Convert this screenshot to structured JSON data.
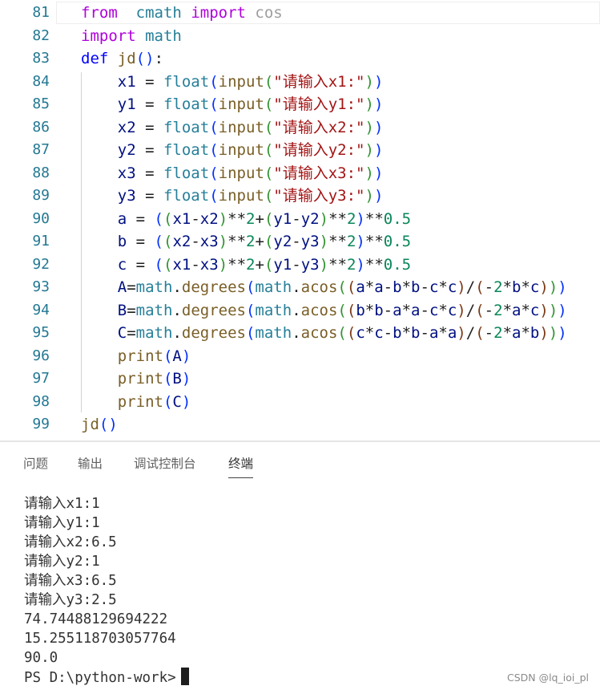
{
  "editor": {
    "lines": [
      {
        "num": "81",
        "tokens": [
          [
            "kw",
            "from"
          ],
          [
            "",
            "  "
          ],
          [
            "mod",
            "cmath"
          ],
          [
            "",
            " "
          ],
          [
            "kw",
            "import"
          ],
          [
            "",
            " "
          ],
          [
            "faded",
            "cos"
          ]
        ]
      },
      {
        "num": "82",
        "tokens": [
          [
            "kw",
            "import"
          ],
          [
            "",
            " "
          ],
          [
            "mod",
            "math"
          ]
        ]
      },
      {
        "num": "83",
        "tokens": [
          [
            "kwb",
            "def"
          ],
          [
            "",
            " "
          ],
          [
            "fn",
            "jd"
          ],
          [
            "p1",
            "()"
          ],
          [
            "",
            ":"
          ]
        ]
      },
      {
        "num": "84",
        "tokens": [
          [
            "",
            "    "
          ],
          [
            "var",
            "x1"
          ],
          [
            "",
            " = "
          ],
          [
            "mod",
            "float"
          ],
          [
            "p1",
            "("
          ],
          [
            "fn",
            "input"
          ],
          [
            "p2",
            "("
          ],
          [
            "str",
            "\"请输入x1:\""
          ],
          [
            "p2",
            ")"
          ],
          [
            "p1",
            ")"
          ]
        ]
      },
      {
        "num": "85",
        "tokens": [
          [
            "",
            "    "
          ],
          [
            "var",
            "y1"
          ],
          [
            "",
            " = "
          ],
          [
            "mod",
            "float"
          ],
          [
            "p1",
            "("
          ],
          [
            "fn",
            "input"
          ],
          [
            "p2",
            "("
          ],
          [
            "str",
            "\"请输入y1:\""
          ],
          [
            "p2",
            ")"
          ],
          [
            "p1",
            ")"
          ]
        ]
      },
      {
        "num": "86",
        "tokens": [
          [
            "",
            "    "
          ],
          [
            "var",
            "x2"
          ],
          [
            "",
            " = "
          ],
          [
            "mod",
            "float"
          ],
          [
            "p1",
            "("
          ],
          [
            "fn",
            "input"
          ],
          [
            "p2",
            "("
          ],
          [
            "str",
            "\"请输入x2:\""
          ],
          [
            "p2",
            ")"
          ],
          [
            "p1",
            ")"
          ]
        ]
      },
      {
        "num": "87",
        "tokens": [
          [
            "",
            "    "
          ],
          [
            "var",
            "y2"
          ],
          [
            "",
            " = "
          ],
          [
            "mod",
            "float"
          ],
          [
            "p1",
            "("
          ],
          [
            "fn",
            "input"
          ],
          [
            "p2",
            "("
          ],
          [
            "str",
            "\"请输入y2:\""
          ],
          [
            "p2",
            ")"
          ],
          [
            "p1",
            ")"
          ]
        ]
      },
      {
        "num": "88",
        "tokens": [
          [
            "",
            "    "
          ],
          [
            "var",
            "x3"
          ],
          [
            "",
            " = "
          ],
          [
            "mod",
            "float"
          ],
          [
            "p1",
            "("
          ],
          [
            "fn",
            "input"
          ],
          [
            "p2",
            "("
          ],
          [
            "str",
            "\"请输入x3:\""
          ],
          [
            "p2",
            ")"
          ],
          [
            "p1",
            ")"
          ]
        ]
      },
      {
        "num": "89",
        "tokens": [
          [
            "",
            "    "
          ],
          [
            "var",
            "y3"
          ],
          [
            "",
            " = "
          ],
          [
            "mod",
            "float"
          ],
          [
            "p1",
            "("
          ],
          [
            "fn",
            "input"
          ],
          [
            "p2",
            "("
          ],
          [
            "str",
            "\"请输入y3:\""
          ],
          [
            "p2",
            ")"
          ],
          [
            "p1",
            ")"
          ]
        ]
      },
      {
        "num": "90",
        "tokens": [
          [
            "",
            "    "
          ],
          [
            "var",
            "a"
          ],
          [
            "",
            " = "
          ],
          [
            "p1",
            "("
          ],
          [
            "p2",
            "("
          ],
          [
            "var",
            "x1"
          ],
          [
            "",
            "-"
          ],
          [
            "var",
            "x2"
          ],
          [
            "p2",
            ")"
          ],
          [
            "",
            "**"
          ],
          [
            "num",
            "2"
          ],
          [
            "",
            "+"
          ],
          [
            "p2",
            "("
          ],
          [
            "var",
            "y1"
          ],
          [
            "",
            "-"
          ],
          [
            "var",
            "y2"
          ],
          [
            "p2",
            ")"
          ],
          [
            "",
            "**"
          ],
          [
            "num",
            "2"
          ],
          [
            "p1",
            ")"
          ],
          [
            "",
            "**"
          ],
          [
            "num",
            "0.5"
          ]
        ]
      },
      {
        "num": "91",
        "tokens": [
          [
            "",
            "    "
          ],
          [
            "var",
            "b"
          ],
          [
            "",
            " = "
          ],
          [
            "p1",
            "("
          ],
          [
            "p2",
            "("
          ],
          [
            "var",
            "x2"
          ],
          [
            "",
            "-"
          ],
          [
            "var",
            "x3"
          ],
          [
            "p2",
            ")"
          ],
          [
            "",
            "**"
          ],
          [
            "num",
            "2"
          ],
          [
            "",
            "+"
          ],
          [
            "p2",
            "("
          ],
          [
            "var",
            "y2"
          ],
          [
            "",
            "-"
          ],
          [
            "var",
            "y3"
          ],
          [
            "p2",
            ")"
          ],
          [
            "",
            "**"
          ],
          [
            "num",
            "2"
          ],
          [
            "p1",
            ")"
          ],
          [
            "",
            "**"
          ],
          [
            "num",
            "0.5"
          ]
        ]
      },
      {
        "num": "92",
        "tokens": [
          [
            "",
            "    "
          ],
          [
            "var",
            "c"
          ],
          [
            "",
            " = "
          ],
          [
            "p1",
            "("
          ],
          [
            "p2",
            "("
          ],
          [
            "var",
            "x1"
          ],
          [
            "",
            "-"
          ],
          [
            "var",
            "x3"
          ],
          [
            "p2",
            ")"
          ],
          [
            "",
            "**"
          ],
          [
            "num",
            "2"
          ],
          [
            "",
            "+"
          ],
          [
            "p2",
            "("
          ],
          [
            "var",
            "y1"
          ],
          [
            "",
            "-"
          ],
          [
            "var",
            "y3"
          ],
          [
            "p2",
            ")"
          ],
          [
            "",
            "**"
          ],
          [
            "num",
            "2"
          ],
          [
            "p1",
            ")"
          ],
          [
            "",
            "**"
          ],
          [
            "num",
            "0.5"
          ]
        ]
      },
      {
        "num": "93",
        "tokens": [
          [
            "",
            "    "
          ],
          [
            "var",
            "A"
          ],
          [
            "",
            "="
          ],
          [
            "mod",
            "math"
          ],
          [
            "",
            "."
          ],
          [
            "fn",
            "degrees"
          ],
          [
            "p1",
            "("
          ],
          [
            "mod",
            "math"
          ],
          [
            "",
            "."
          ],
          [
            "fn",
            "acos"
          ],
          [
            "p2",
            "("
          ],
          [
            "p3",
            "("
          ],
          [
            "var",
            "a"
          ],
          [
            "",
            "*"
          ],
          [
            "var",
            "a"
          ],
          [
            "",
            "-"
          ],
          [
            "var",
            "b"
          ],
          [
            "",
            "*"
          ],
          [
            "var",
            "b"
          ],
          [
            "",
            "-"
          ],
          [
            "var",
            "c"
          ],
          [
            "",
            "*"
          ],
          [
            "var",
            "c"
          ],
          [
            "p3",
            ")"
          ],
          [
            "",
            "/"
          ],
          [
            "p3",
            "("
          ],
          [
            "",
            "-"
          ],
          [
            "num",
            "2"
          ],
          [
            "",
            "*"
          ],
          [
            "var",
            "b"
          ],
          [
            "",
            "*"
          ],
          [
            "var",
            "c"
          ],
          [
            "p3",
            ")"
          ],
          [
            "p2",
            ")"
          ],
          [
            "p1",
            ")"
          ]
        ]
      },
      {
        "num": "94",
        "tokens": [
          [
            "",
            "    "
          ],
          [
            "var",
            "B"
          ],
          [
            "",
            "="
          ],
          [
            "mod",
            "math"
          ],
          [
            "",
            "."
          ],
          [
            "fn",
            "degrees"
          ],
          [
            "p1",
            "("
          ],
          [
            "mod",
            "math"
          ],
          [
            "",
            "."
          ],
          [
            "fn",
            "acos"
          ],
          [
            "p2",
            "("
          ],
          [
            "p3",
            "("
          ],
          [
            "var",
            "b"
          ],
          [
            "",
            "*"
          ],
          [
            "var",
            "b"
          ],
          [
            "",
            "-"
          ],
          [
            "var",
            "a"
          ],
          [
            "",
            "*"
          ],
          [
            "var",
            "a"
          ],
          [
            "",
            "-"
          ],
          [
            "var",
            "c"
          ],
          [
            "",
            "*"
          ],
          [
            "var",
            "c"
          ],
          [
            "p3",
            ")"
          ],
          [
            "",
            "/"
          ],
          [
            "p3",
            "("
          ],
          [
            "",
            "-"
          ],
          [
            "num",
            "2"
          ],
          [
            "",
            "*"
          ],
          [
            "var",
            "a"
          ],
          [
            "",
            "*"
          ],
          [
            "var",
            "c"
          ],
          [
            "p3",
            ")"
          ],
          [
            "p2",
            ")"
          ],
          [
            "p1",
            ")"
          ]
        ]
      },
      {
        "num": "95",
        "tokens": [
          [
            "",
            "    "
          ],
          [
            "var",
            "C"
          ],
          [
            "",
            "="
          ],
          [
            "mod",
            "math"
          ],
          [
            "",
            "."
          ],
          [
            "fn",
            "degrees"
          ],
          [
            "p1",
            "("
          ],
          [
            "mod",
            "math"
          ],
          [
            "",
            "."
          ],
          [
            "fn",
            "acos"
          ],
          [
            "p2",
            "("
          ],
          [
            "p3",
            "("
          ],
          [
            "var",
            "c"
          ],
          [
            "",
            "*"
          ],
          [
            "var",
            "c"
          ],
          [
            "",
            "-"
          ],
          [
            "var",
            "b"
          ],
          [
            "",
            "*"
          ],
          [
            "var",
            "b"
          ],
          [
            "",
            "-"
          ],
          [
            "var",
            "a"
          ],
          [
            "",
            "*"
          ],
          [
            "var",
            "a"
          ],
          [
            "p3",
            ")"
          ],
          [
            "",
            "/"
          ],
          [
            "p3",
            "("
          ],
          [
            "",
            "-"
          ],
          [
            "num",
            "2"
          ],
          [
            "",
            "*"
          ],
          [
            "var",
            "a"
          ],
          [
            "",
            "*"
          ],
          [
            "var",
            "b"
          ],
          [
            "p3",
            ")"
          ],
          [
            "p2",
            ")"
          ],
          [
            "p1",
            ")"
          ]
        ]
      },
      {
        "num": "96",
        "tokens": [
          [
            "",
            "    "
          ],
          [
            "fn",
            "print"
          ],
          [
            "p1",
            "("
          ],
          [
            "var",
            "A"
          ],
          [
            "p1",
            ")"
          ]
        ]
      },
      {
        "num": "97",
        "tokens": [
          [
            "",
            "    "
          ],
          [
            "fn",
            "print"
          ],
          [
            "p1",
            "("
          ],
          [
            "var",
            "B"
          ],
          [
            "p1",
            ")"
          ]
        ]
      },
      {
        "num": "98",
        "tokens": [
          [
            "",
            "    "
          ],
          [
            "fn",
            "print"
          ],
          [
            "p1",
            "("
          ],
          [
            "var",
            "C"
          ],
          [
            "p1",
            ")"
          ]
        ]
      },
      {
        "num": "99",
        "tokens": [
          [
            "fn",
            "jd"
          ],
          [
            "p1",
            "()"
          ]
        ]
      }
    ]
  },
  "panel": {
    "tabs": [
      {
        "label": "问题",
        "active": false
      },
      {
        "label": "输出",
        "active": false
      },
      {
        "label": "调试控制台",
        "active": false
      },
      {
        "label": "终端",
        "active": true
      }
    ],
    "terminal_lines": [
      "请输入x1:1",
      "请输入y1:1",
      "请输入x2:6.5",
      "请输入y2:1",
      "请输入x3:6.5",
      "请输入y3:2.5",
      "74.74488129694222",
      "15.255118703057764",
      "90.0"
    ],
    "prompt": "PS D:\\python-work>"
  },
  "watermark": "CSDN @lq_ioi_pl"
}
